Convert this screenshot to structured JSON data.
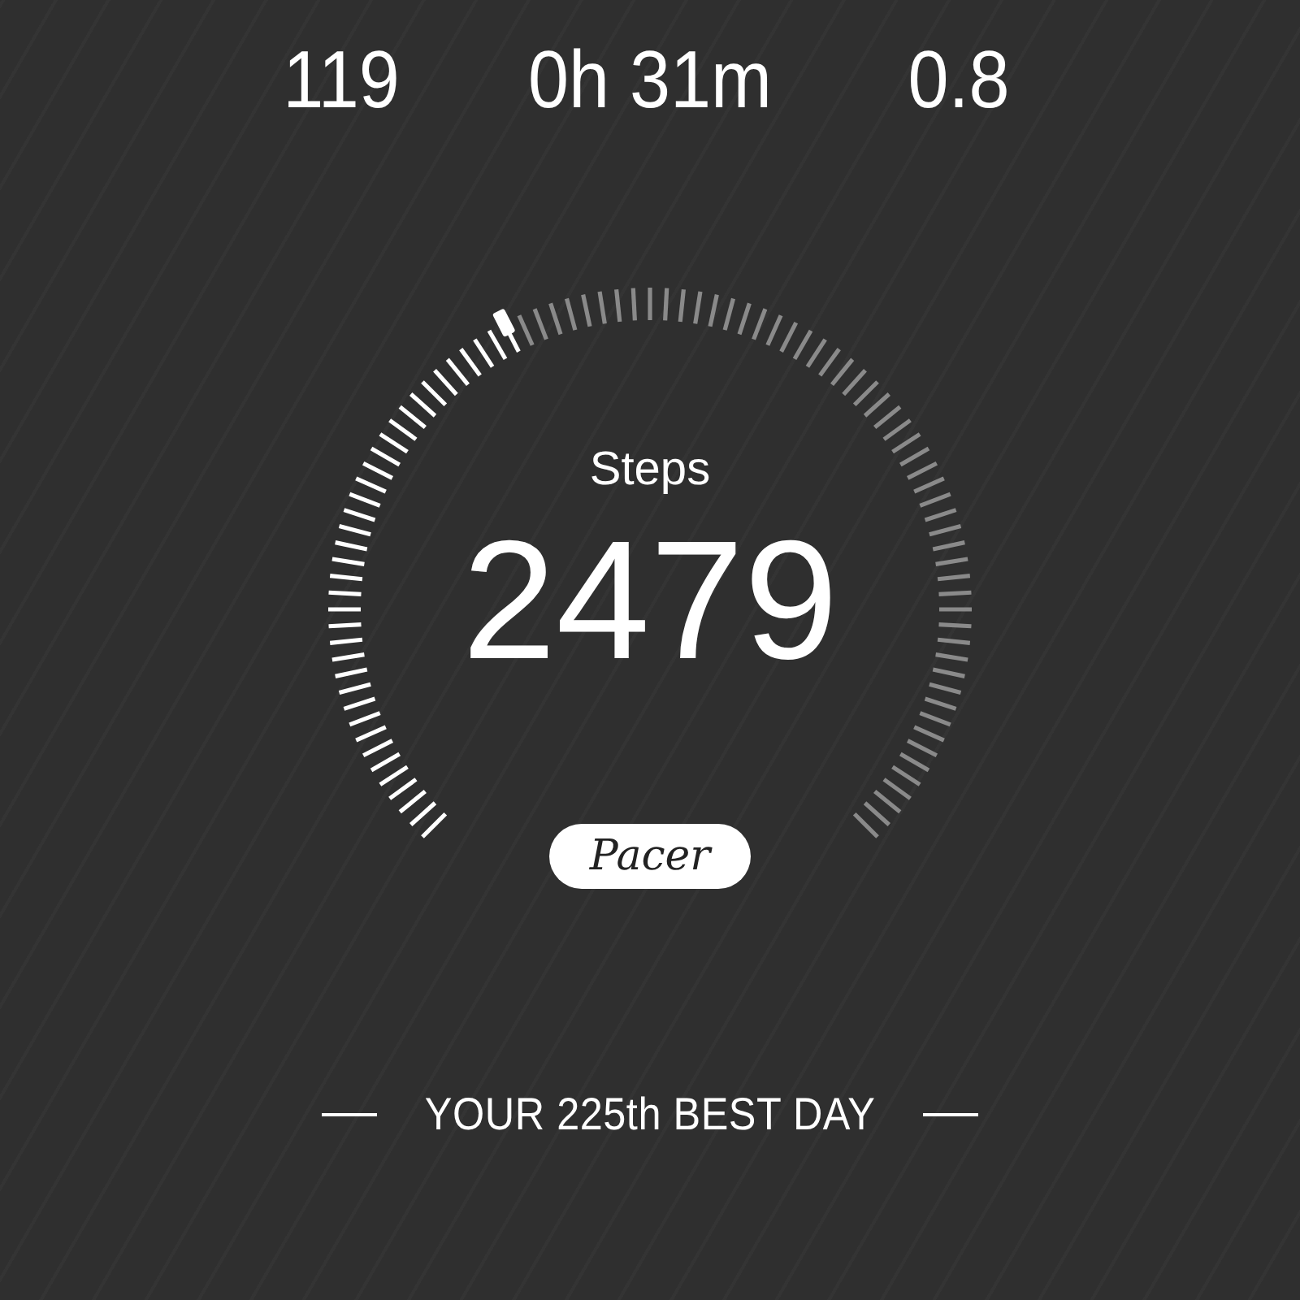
{
  "stats": [
    {
      "value": "119"
    },
    {
      "value": "0h 31m"
    },
    {
      "value": "0.8"
    }
  ],
  "gauge": {
    "label": "Steps",
    "value": "2479",
    "badge": "Pacer"
  },
  "rank": {
    "text": "YOUR 225th BEST DAY"
  }
}
